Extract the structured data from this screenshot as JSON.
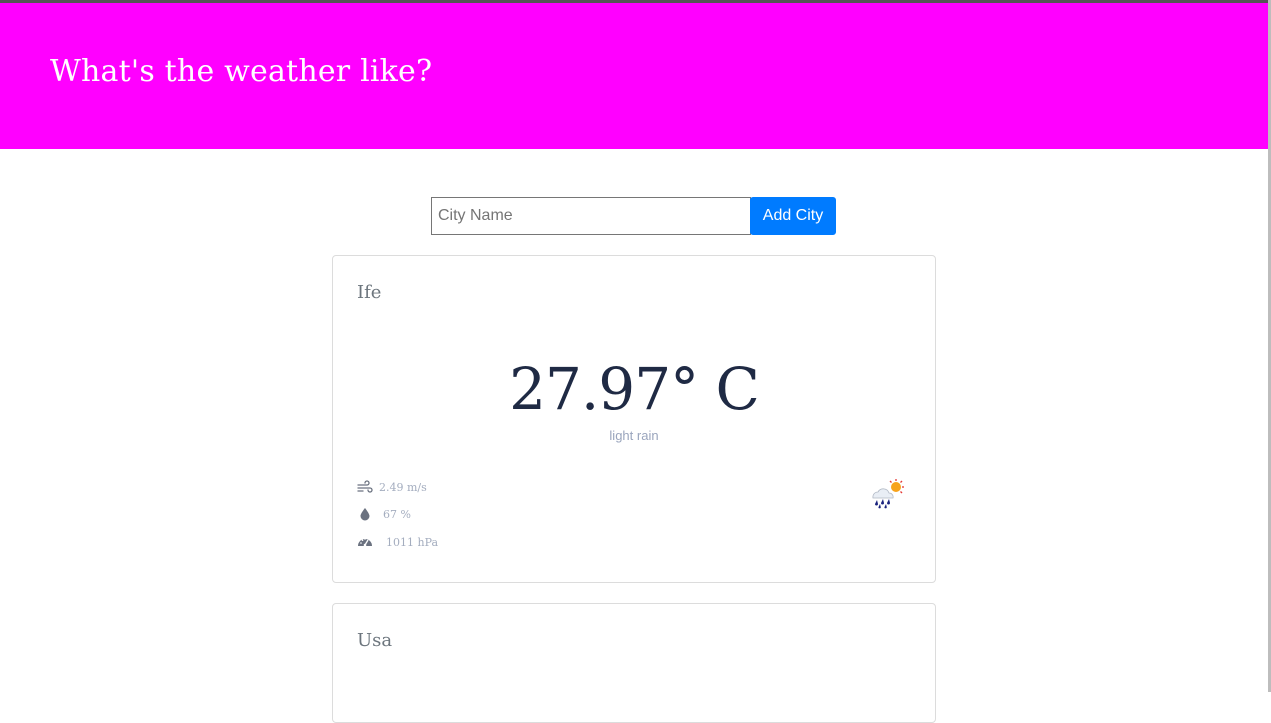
{
  "header": {
    "title": "What's the weather like?"
  },
  "search": {
    "placeholder": "City Name",
    "value": "",
    "button_label": "Add City"
  },
  "cards": [
    {
      "city": "Ife",
      "temperature": "27.97° C",
      "description": "light rain",
      "wind": "2.49 m/s",
      "humidity": "67 %",
      "pressure": "1011 hPa",
      "wind_icon": "wind-icon",
      "humidity_icon": "droplet-icon",
      "pressure_icon": "gauge-icon",
      "weather_icon": "rain-sun-icon"
    },
    {
      "city": "Usa"
    }
  ],
  "colors": {
    "header_bg": "#ff00ff",
    "button_bg": "#007bff",
    "temp_text": "#1f2a44",
    "muted_text": "#a4adbf"
  }
}
